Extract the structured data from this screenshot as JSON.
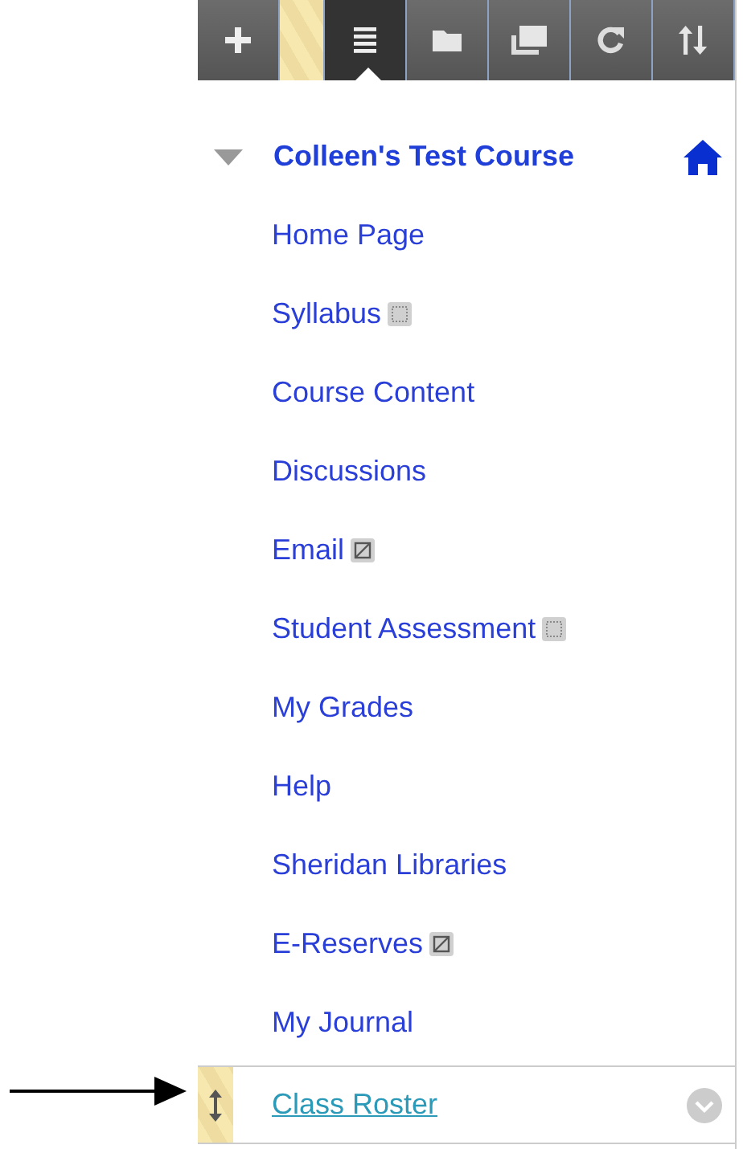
{
  "toolbar": [
    {
      "kind": "plus",
      "selected": false
    },
    {
      "kind": "list",
      "selected": true
    },
    {
      "kind": "folder",
      "selected": false
    },
    {
      "kind": "windows",
      "selected": false
    },
    {
      "kind": "refresh",
      "selected": false
    },
    {
      "kind": "sort",
      "selected": false
    }
  ],
  "course": {
    "title": "Colleen's Test Course",
    "expanded": true
  },
  "menu": [
    {
      "label": "Home Page",
      "kind": "plain",
      "focused": false
    },
    {
      "label": "Syllabus",
      "kind": "hidden",
      "focused": false
    },
    {
      "label": "Course Content",
      "kind": "plain",
      "focused": false
    },
    {
      "label": "Discussions",
      "kind": "plain",
      "focused": false
    },
    {
      "label": "Email",
      "kind": "unavailable",
      "focused": false
    },
    {
      "label": "Student Assessment",
      "kind": "hidden",
      "focused": false
    },
    {
      "label": "My Grades",
      "kind": "plain",
      "focused": false
    },
    {
      "label": "Help",
      "kind": "plain",
      "focused": false
    },
    {
      "label": "Sheridan Libraries",
      "kind": "plain",
      "focused": false
    },
    {
      "label": "E-Reserves",
      "kind": "unavailable",
      "focused": false
    },
    {
      "label": "My Journal",
      "kind": "plain",
      "focused": false
    },
    {
      "label": "Class Roster",
      "kind": "plain",
      "focused": true
    }
  ]
}
